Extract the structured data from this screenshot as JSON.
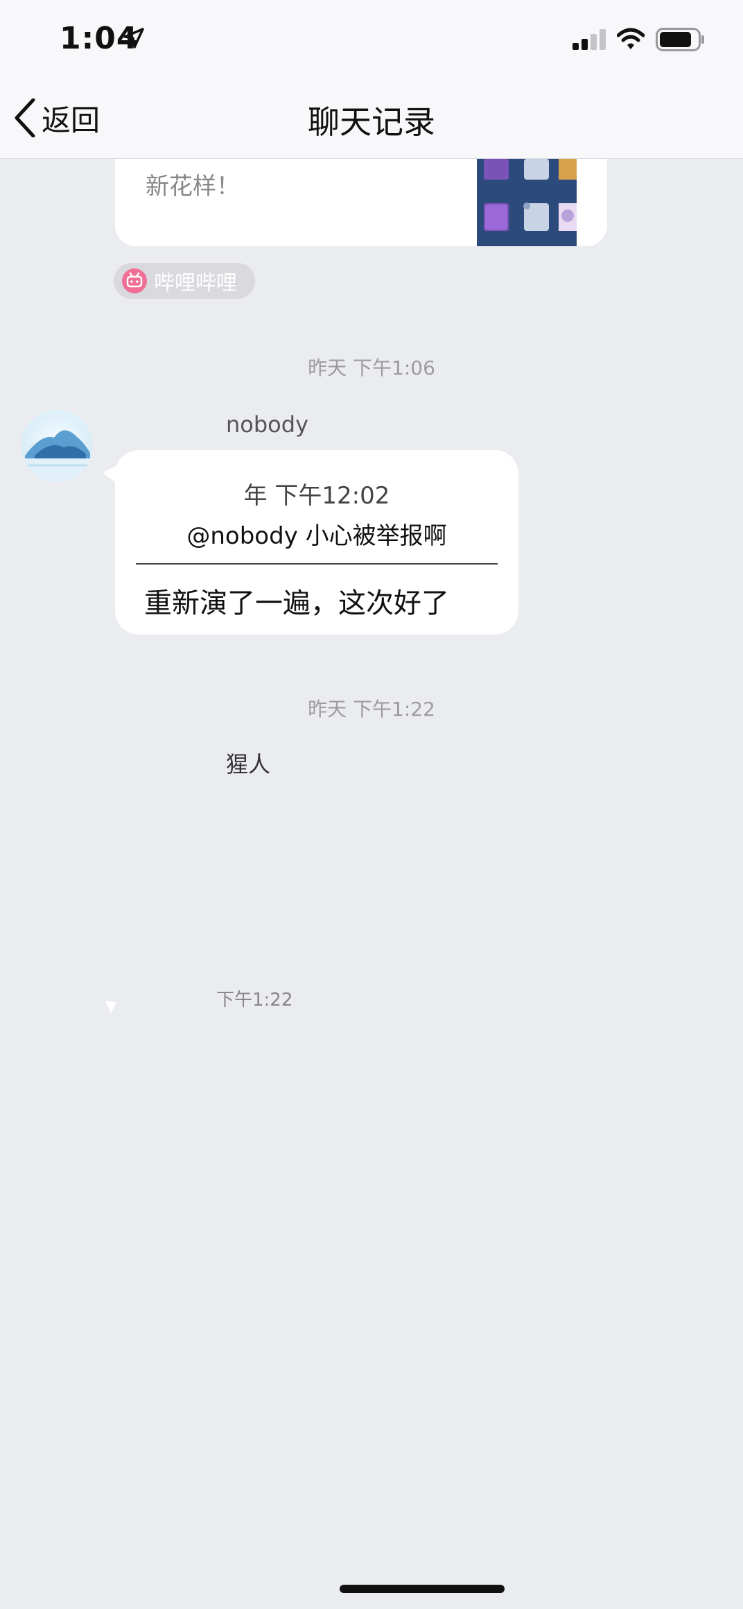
{
  "status_bar": {
    "time": "1:04"
  },
  "nav": {
    "back_label": "返回",
    "title": "聊天记录"
  },
  "card": {
    "text": "新花样！"
  },
  "source": {
    "label": "哔哩哔哩"
  },
  "messages": {
    "timestamp_1": "昨天 下午1:06",
    "sender": "nobody",
    "quote_time": "年 下午12:02",
    "quote_text": "@nobody 小心被举报啊",
    "reply_text": "重新演了一遍，这次好了",
    "timestamp_2": "昨天 下午1:22",
    "text_2": "猩人",
    "ghost_time": "下午1:22"
  },
  "colors": {
    "background": "#ebecf0",
    "bubble": "#ffffff",
    "badge": "#d9d9de",
    "source_logo": "#f06f97"
  }
}
